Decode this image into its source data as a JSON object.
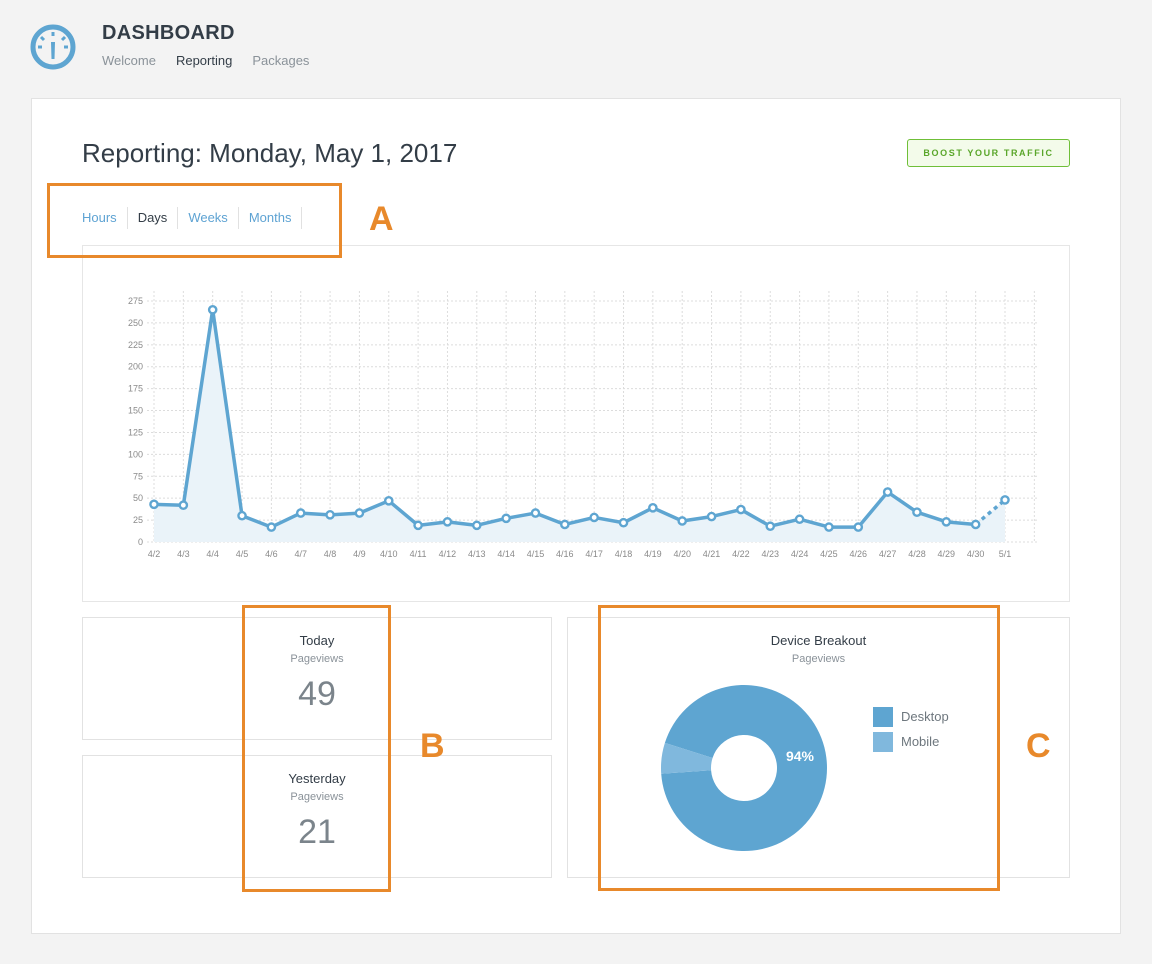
{
  "header": {
    "app_title": "DASHBOARD",
    "logo_icon": "speedometer-icon",
    "nav": [
      "Welcome",
      "Reporting",
      "Packages"
    ],
    "active_nav": "Reporting"
  },
  "main": {
    "page_title": "Reporting: Monday, May 1, 2017",
    "boost_button": "BOOST YOUR TRAFFIC",
    "range_tabs": [
      "Hours",
      "Days",
      "Weeks",
      "Months"
    ],
    "active_range": "Days"
  },
  "chart_data": [
    {
      "type": "line",
      "x": [
        "4/2",
        "4/3",
        "4/4",
        "4/5",
        "4/6",
        "4/7",
        "4/8",
        "4/9",
        "4/10",
        "4/11",
        "4/12",
        "4/13",
        "4/14",
        "4/15",
        "4/16",
        "4/17",
        "4/18",
        "4/19",
        "4/20",
        "4/21",
        "4/22",
        "4/23",
        "4/24",
        "4/25",
        "4/26",
        "4/27",
        "4/28",
        "4/29",
        "4/30",
        "5/1"
      ],
      "series": [
        {
          "values": [
            43,
            42,
            265,
            30,
            17,
            33,
            31,
            33,
            47,
            19,
            23,
            19,
            27,
            33,
            20,
            28,
            22,
            39,
            24,
            29,
            37,
            18,
            26,
            17,
            17,
            57,
            34,
            23,
            20,
            48
          ]
        }
      ],
      "yticks": [
        0,
        25,
        50,
        75,
        100,
        125,
        150,
        175,
        200,
        225,
        250,
        275
      ],
      "ylim": [
        0,
        275
      ],
      "grid": true,
      "title": "",
      "xlabel": "",
      "ylabel": "",
      "color": "#5ea5d1",
      "note_dotted_last_segment": true
    },
    {
      "type": "pie",
      "title": "Device Breakout",
      "subtitle": "Pageviews",
      "labels": [
        "Desktop",
        "Mobile"
      ],
      "values": [
        94,
        6
      ],
      "data_labels": [
        "94%",
        ""
      ],
      "colors": [
        "#5ea5d1",
        "#80b8dd"
      ],
      "donut": true
    }
  ],
  "stats": [
    {
      "title": "Today",
      "subtitle": "Pageviews",
      "value": "49"
    },
    {
      "title": "Yesterday",
      "subtitle": "Pageviews",
      "value": "21"
    }
  ],
  "annotations": [
    "A",
    "B",
    "C"
  ],
  "colors": {
    "accent": "#5ea5d1",
    "annotation": "#e8892b",
    "boost": "#6fbf38"
  }
}
